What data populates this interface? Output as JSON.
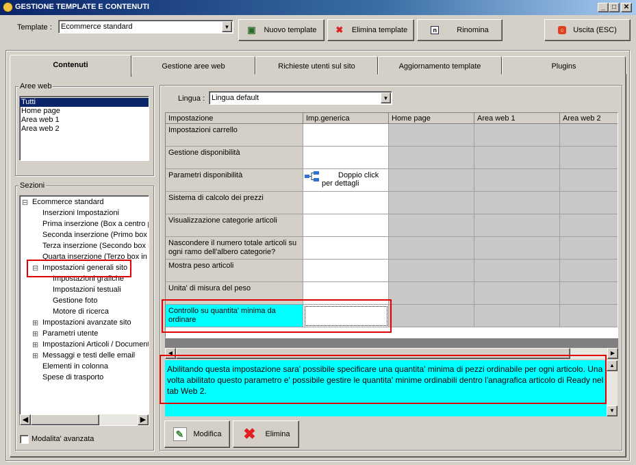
{
  "window": {
    "title": "GESTIONE TEMPLATE E CONTENUTI",
    "min": "_",
    "max": "□",
    "close": "✕"
  },
  "toolbar": {
    "template_label": "Template :",
    "template_value": "Ecommerce standard",
    "new_template": "Nuovo template",
    "delete_template": "Elimina template",
    "rename": "Rinomina",
    "exit": "Uscita (ESC)"
  },
  "tabs": [
    "Contenuti",
    "Gestione aree web",
    "Richieste utenti sul sito",
    "Aggiornamento template",
    "Plugins"
  ],
  "aree_web": {
    "label": "Aree web",
    "items": [
      "Tutti",
      "Home page",
      "Area web 1",
      "Area web 2"
    ]
  },
  "sezioni": {
    "label": "Sezioni",
    "items": [
      "Ecommerce standard",
      "Inserzioni Impostazioni",
      "Prima inserzione (Box a centro pa",
      "Seconda inserzione (Primo box in",
      "Terza inserzione (Secondo box in",
      "Quarta inserzione (Terzo box in b",
      "Impostazioni generali sito",
      "Impostazioni grafiche",
      "Impostazioni testuali",
      "Gestione foto",
      "Motore di ricerca",
      "Impostazioni avanzate sito",
      "Parametri utente",
      "Impostazioni Articoli / Documenti",
      "Messaggi e testi delle email",
      "Elementi in colonna",
      "Spese di trasporto"
    ]
  },
  "advanced_mode": "Modalita' avanzata",
  "lingua": {
    "label": "Lingua :",
    "value": "Lingua default"
  },
  "grid": {
    "headers": [
      "Impostazione",
      "Imp.generica",
      "Home page",
      "Area web 1",
      "Area web 2"
    ],
    "rows": [
      "Impostazioni carrello",
      "Gestione disponibilità",
      "Parametri disponibilità",
      "Sistema di calcolo dei prezzi",
      "Visualizzazione categorie articoli",
      "Nascondere il numero totale articoli su ogni ramo dell'albero categorie?",
      "Mostra peso articoli",
      "Unita' di misura del peso",
      "Controllo su quantita' minima da ordinare"
    ],
    "detail_text_1": "Doppio click",
    "detail_text_2": "per dettagli"
  },
  "description": "Abilitando questa impostazione sara' possibile specificare una quantita' minima di pezzi ordinabile per ogni articolo. Una volta abilitato questo parametro e' possibile gestire le quantita' minime ordinabili dentro l'anagrafica articolo di Ready nel tab Web 2.",
  "actions": {
    "modify": "Modifica",
    "delete": "Elimina"
  }
}
